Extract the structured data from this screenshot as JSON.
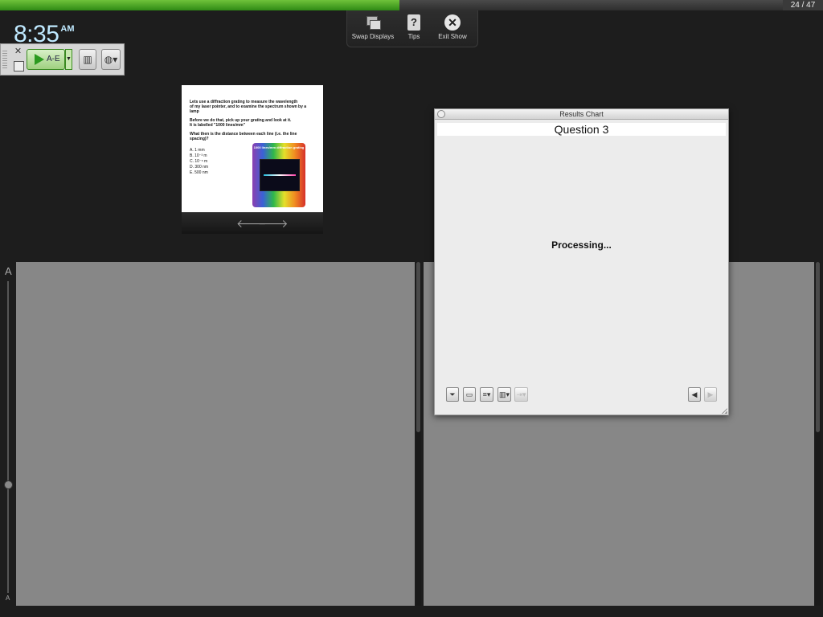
{
  "progress": {
    "fraction": 0.4851,
    "counter": "24 / 47"
  },
  "clock": {
    "time": "8:35",
    "ampm": "AM"
  },
  "show_toolbar": {
    "swap_label": "Swap Displays",
    "tips_label": "Tips",
    "tips_glyph": "?",
    "exit_label": "Exit Show",
    "exit_glyph": "✕"
  },
  "mini_toolbar": {
    "close_glyph": "✕",
    "play_label": "A-E",
    "dropdown_glyph": "▼",
    "chart_glyph": "▥",
    "globe_glyph": "◍▾"
  },
  "slide": {
    "line1": "Lets use a diffraction grating to measure the wavelength",
    "line2": "of my laser pointer, and to examine the spectrum shown by a lamp",
    "line3": "Before we do that, pick up your grating and look at it.",
    "line4": "It is labelled \"1000 lines/mm\"",
    "question": "What then is the distance between each line (i.e. the line spacing)?",
    "options": [
      "A.  1 mm",
      "B.  10⁻³ m",
      "C.  10⁻⁶ m",
      "D.  300 nm",
      "E.  500 nm"
    ],
    "grating_label": "1000 lines/mm diffraction grating",
    "nav_prev": "🡐",
    "nav_next": "🡒"
  },
  "panels": {
    "label_a": "A",
    "label_a_bottom": "A"
  },
  "results": {
    "window_title": "Results Chart",
    "question_title": "Question 3",
    "status": "Processing...",
    "buttons": [
      "funnel-icon",
      "window-icon",
      "list-icon",
      "chart-settings-icon",
      "export-icon"
    ],
    "btn_glyphs": [
      "⏷",
      "▭",
      "≡▾",
      "▥▾",
      "⇥▾"
    ],
    "prev_glyph": "◀",
    "next_glyph": "▶"
  },
  "colors": {
    "accent_green": "#4fb02a",
    "clock_blue": "#bfe9ff",
    "panel_gray": "#878787"
  }
}
